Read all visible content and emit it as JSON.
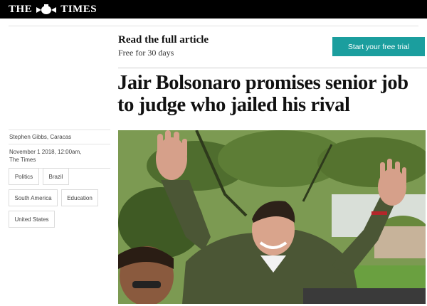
{
  "header": {
    "logo_left": "THE",
    "logo_right": "TIMES",
    "crest_icon": "royal-crest-icon"
  },
  "promo": {
    "title": "Read the full article",
    "subtitle": "Free for 30 days",
    "button_label": "Start your free trial",
    "button_color": "#1b9e9e"
  },
  "article": {
    "headline": "Jair Bolsonaro promises senior job to judge who jailed his rival",
    "byline": "Stephen Gibbs, Caracas",
    "date": "November 1 2018, 12:00am,",
    "publication": "The Times",
    "tags": [
      "Politics",
      "Brazil",
      "South America",
      "Education",
      "United States"
    ]
  }
}
